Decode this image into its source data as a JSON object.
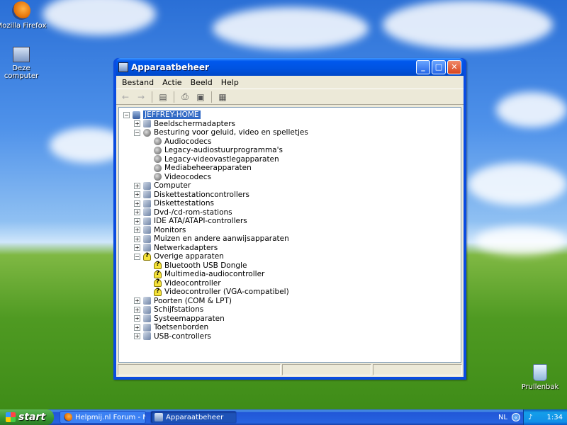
{
  "desktop": {
    "icons": [
      {
        "label": "Mozilla Firefox",
        "icon": "firefox-icon"
      },
      {
        "label": "Deze computer",
        "icon": "computer-icon"
      },
      {
        "label": "Prullenbak",
        "icon": "recycle-bin-icon"
      }
    ]
  },
  "window": {
    "title": "Apparaatbeheer",
    "menu": [
      "Bestand",
      "Actie",
      "Beeld",
      "Help"
    ],
    "toolbar": [
      "back-icon",
      "forward-icon",
      "console-tree-icon",
      "print-icon",
      "properties-icon",
      "help-icon"
    ],
    "tree": {
      "root": "JEFFREY-HOME",
      "items": [
        {
          "label": "Beeldschermadapters",
          "level": 1,
          "expander": "+",
          "icon": "display-adapter-icon"
        },
        {
          "label": "Besturing voor geluid, video en spelletjes",
          "level": 1,
          "expander": "-",
          "icon": "sound-icon"
        },
        {
          "label": "Audiocodecs",
          "level": 2,
          "expander": "",
          "icon": "sound-icon"
        },
        {
          "label": "Legacy-audiostuurprogramma's",
          "level": 2,
          "expander": "",
          "icon": "sound-icon"
        },
        {
          "label": "Legacy-videovastlegapparaten",
          "level": 2,
          "expander": "",
          "icon": "sound-icon"
        },
        {
          "label": "Mediabeheerapparaten",
          "level": 2,
          "expander": "",
          "icon": "sound-icon"
        },
        {
          "label": "Videocodecs",
          "level": 2,
          "expander": "",
          "icon": "sound-icon"
        },
        {
          "label": "Computer",
          "level": 1,
          "expander": "+",
          "icon": "computer-icon"
        },
        {
          "label": "Diskettestationcontrollers",
          "level": 1,
          "expander": "+",
          "icon": "controller-icon"
        },
        {
          "label": "Diskettestations",
          "level": 1,
          "expander": "+",
          "icon": "floppy-icon"
        },
        {
          "label": "Dvd-/cd-rom-stations",
          "level": 1,
          "expander": "+",
          "icon": "cdrom-icon"
        },
        {
          "label": "IDE ATA/ATAPI-controllers",
          "level": 1,
          "expander": "+",
          "icon": "ide-icon"
        },
        {
          "label": "Monitors",
          "level": 1,
          "expander": "+",
          "icon": "monitor-icon"
        },
        {
          "label": "Muizen en andere aanwijsapparaten",
          "level": 1,
          "expander": "+",
          "icon": "mouse-icon"
        },
        {
          "label": "Netwerkadapters",
          "level": 1,
          "expander": "+",
          "icon": "network-icon"
        },
        {
          "label": "Overige apparaten",
          "level": 1,
          "expander": "-",
          "icon": "unknown-device-icon"
        },
        {
          "label": "Bluetooth USB Dongle",
          "level": 2,
          "expander": "",
          "icon": "warning-device-icon"
        },
        {
          "label": "Multimedia-audiocontroller",
          "level": 2,
          "expander": "",
          "icon": "warning-device-icon"
        },
        {
          "label": "Videocontroller",
          "level": 2,
          "expander": "",
          "icon": "warning-device-icon"
        },
        {
          "label": "Videocontroller (VGA-compatibel)",
          "level": 2,
          "expander": "",
          "icon": "warning-device-icon"
        },
        {
          "label": "Poorten (COM & LPT)",
          "level": 1,
          "expander": "+",
          "icon": "port-icon"
        },
        {
          "label": "Schijfstations",
          "level": 1,
          "expander": "+",
          "icon": "disk-icon"
        },
        {
          "label": "Systeemapparaten",
          "level": 1,
          "expander": "+",
          "icon": "system-icon"
        },
        {
          "label": "Toetsenborden",
          "level": 1,
          "expander": "+",
          "icon": "keyboard-icon"
        },
        {
          "label": "USB-controllers",
          "level": 1,
          "expander": "+",
          "icon": "usb-icon"
        }
      ]
    }
  },
  "taskbar": {
    "start_label": "start",
    "tasks": [
      {
        "label": "Helpmij.nl Forum - Nie...",
        "icon": "firefox-icon",
        "active": false
      },
      {
        "label": "Apparaatbeheer",
        "icon": "device-manager-icon",
        "active": true
      }
    ],
    "language": "NL",
    "clock": "1:34"
  }
}
